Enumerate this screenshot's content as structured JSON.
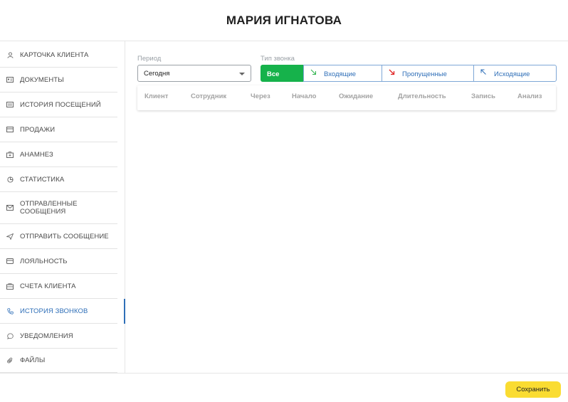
{
  "header": {
    "title": "МАРИЯ ИГНАТОВА"
  },
  "sidebar": {
    "items": [
      {
        "label": "КАРТОЧКА КЛИЕНТА",
        "icon": "user-icon"
      },
      {
        "label": "ДОКУМЕНТЫ",
        "icon": "id-card-icon"
      },
      {
        "label": "ИСТОРИЯ ПОСЕЩЕНИЙ",
        "icon": "list-icon"
      },
      {
        "label": "ПРОДАЖИ",
        "icon": "receipt-icon"
      },
      {
        "label": "АНАМНЕЗ",
        "icon": "medical-case-icon"
      },
      {
        "label": "СТАТИСТИКА",
        "icon": "pie-chart-icon"
      },
      {
        "label": "ОТПРАВЛЕННЫЕ СООБЩЕНИЯ",
        "icon": "envelope-icon"
      },
      {
        "label": "ОТПРАВИТЬ СООБЩЕНИЕ",
        "icon": "send-icon"
      },
      {
        "label": "ЛОЯЛЬНОСТЬ",
        "icon": "card-icon"
      },
      {
        "label": "СЧЕТА КЛИЕНТА",
        "icon": "wallet-icon"
      },
      {
        "label": "ИСТОРИЯ ЗВОНКОВ",
        "icon": "phone-icon",
        "active": true
      },
      {
        "label": "УВЕДОМЛЕНИЯ",
        "icon": "chat-bubble-icon"
      },
      {
        "label": "ФАЙЛЫ",
        "icon": "paperclip-icon"
      }
    ]
  },
  "filters": {
    "period_label": "Период",
    "period_value": "Сегодня",
    "call_type_label": "Тип звонка",
    "call_types": [
      {
        "label": "Все",
        "selected": true
      },
      {
        "label": "Входящие",
        "icon": "incoming-arrow-icon",
        "color": "#2eb34c"
      },
      {
        "label": "Пропущенные",
        "icon": "missed-arrow-icon",
        "color": "#e02424"
      },
      {
        "label": "Исходящие",
        "icon": "outgoing-arrow-icon",
        "color": "#2f6fb8"
      }
    ]
  },
  "table": {
    "columns": [
      "Клиент",
      "Сотрудник",
      "Через",
      "Начало",
      "Ожидание",
      "Длительность",
      "Запись",
      "Анализ"
    ]
  },
  "footer": {
    "save_label": "Сохранить"
  },
  "colors": {
    "accent": "#2f6fb8",
    "all_button": "#16b24b",
    "save_button": "#fadc32"
  }
}
